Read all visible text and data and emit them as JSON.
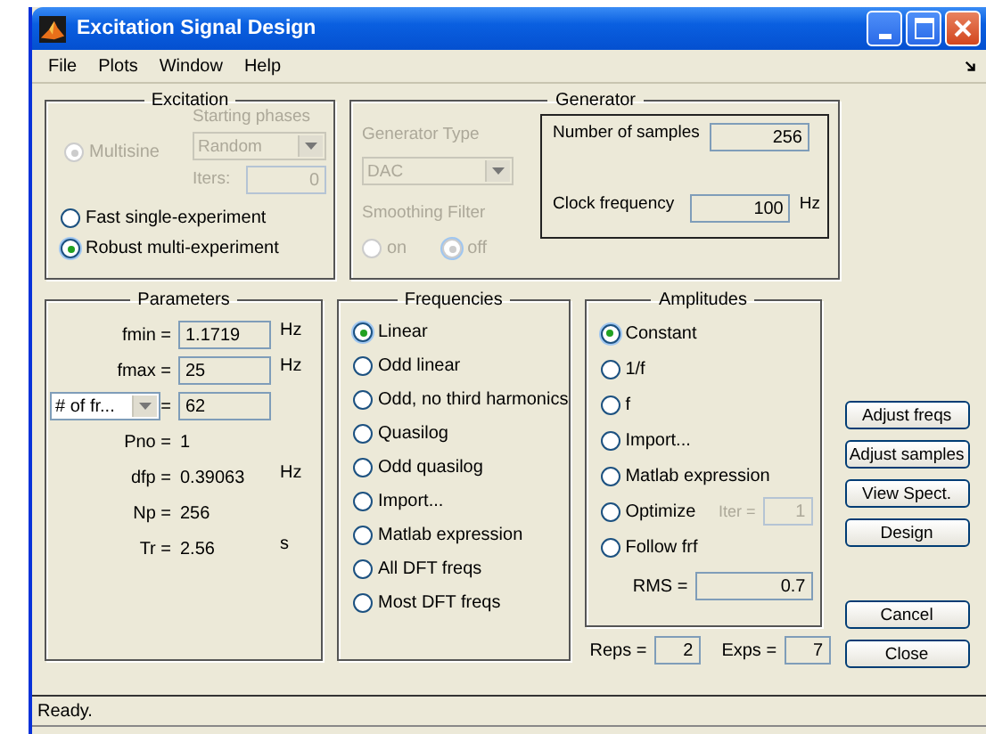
{
  "window": {
    "title": "Excitation Signal Design"
  },
  "menu": [
    {
      "label": "File"
    },
    {
      "label": "Plots"
    },
    {
      "label": "Window"
    },
    {
      "label": "Help"
    }
  ],
  "excitation": {
    "title": "Excitation",
    "multisine": {
      "label": "Multisine",
      "selected": true,
      "disabled": true
    },
    "starting_phases": {
      "label": "Starting phases",
      "value": "Random",
      "disabled": true
    },
    "iters": {
      "label": "Iters:",
      "value": "0",
      "disabled": true
    },
    "modes": [
      {
        "label": "Fast single-experiment",
        "selected": false
      },
      {
        "label": "Robust multi-experiment",
        "selected": true
      }
    ]
  },
  "generator": {
    "title": "Generator",
    "disabled": true,
    "generator_type": {
      "label": "Generator Type",
      "value": "DAC"
    },
    "smoothing_filter": {
      "label": "Smoothing Filter",
      "options": [
        {
          "label": "on",
          "selected": false
        },
        {
          "label": "off",
          "selected": true
        }
      ]
    },
    "number_of_samples": {
      "label": "Number of samples",
      "value": "256"
    },
    "clock_frequency": {
      "label": "Clock frequency",
      "value": "100",
      "unit": "Hz"
    }
  },
  "parameters": {
    "title": "Parameters",
    "rows": [
      {
        "kind": "field",
        "label": "fmin =",
        "value": "1.1719",
        "unit": "Hz"
      },
      {
        "kind": "field",
        "label": "fmax =",
        "value": "25",
        "unit": "Hz"
      },
      {
        "kind": "dropdown",
        "label": "# of fr...",
        "eq": "=",
        "value": "62"
      },
      {
        "kind": "value",
        "label": "Pno =",
        "value": "1"
      },
      {
        "kind": "value",
        "label": "dfp =",
        "value": "0.39063",
        "unit": "Hz"
      },
      {
        "kind": "value",
        "label": "Np =",
        "value": "256"
      },
      {
        "kind": "value",
        "label": "Tr =",
        "value": "2.56",
        "unit": "s"
      }
    ]
  },
  "frequencies": {
    "title": "Frequencies",
    "options": [
      {
        "label": "Linear",
        "selected": true
      },
      {
        "label": "Odd linear",
        "selected": false
      },
      {
        "label": "Odd, no third harmonics",
        "selected": false
      },
      {
        "label": "Quasilog",
        "selected": false
      },
      {
        "label": "Odd quasilog",
        "selected": false
      },
      {
        "label": "Import...",
        "selected": false
      },
      {
        "label": "Matlab expression",
        "selected": false
      },
      {
        "label": "All DFT freqs",
        "selected": false
      },
      {
        "label": "Most DFT freqs",
        "selected": false
      }
    ]
  },
  "amplitudes": {
    "title": "Amplitudes",
    "options": [
      {
        "label": "Constant",
        "selected": true
      },
      {
        "label": "1/f",
        "selected": false
      },
      {
        "label": "f",
        "selected": false
      },
      {
        "label": "Import...",
        "selected": false
      },
      {
        "label": "Matlab expression",
        "selected": false
      },
      {
        "label": "Optimize",
        "selected": false,
        "iter": {
          "label": "Iter =",
          "value": "1",
          "disabled": true
        }
      },
      {
        "label": "Follow frf",
        "selected": false
      }
    ],
    "rms": {
      "label": "RMS =",
      "value": "0.7"
    }
  },
  "reps": {
    "label": "Reps =",
    "value": "2"
  },
  "exps": {
    "label": "Exps =",
    "value": "7"
  },
  "button_groups": [
    {
      "buttons": [
        {
          "label": "Adjust freqs"
        },
        {
          "label": "Adjust samples"
        },
        {
          "label": "View Spect."
        },
        {
          "label": "Design"
        }
      ]
    },
    {
      "buttons": [
        {
          "label": "Cancel"
        },
        {
          "label": "Close"
        }
      ]
    }
  ],
  "status_bar": {
    "text": "Ready."
  }
}
